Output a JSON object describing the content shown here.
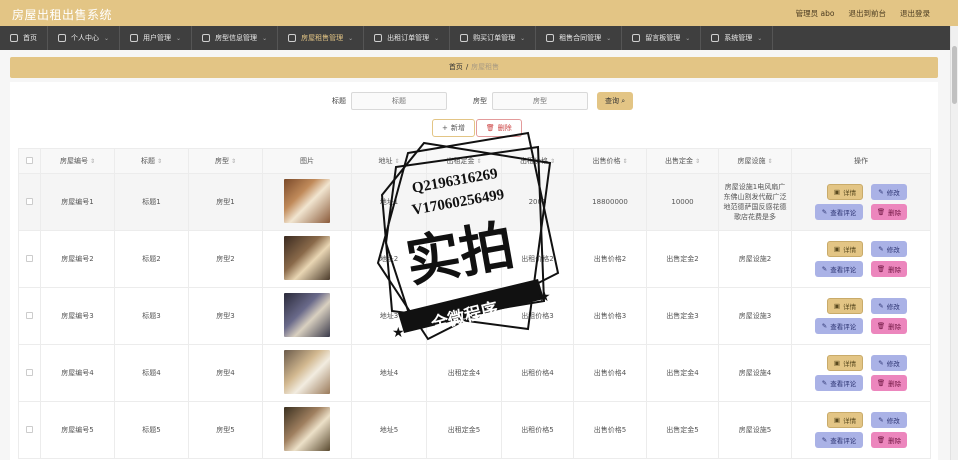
{
  "app": {
    "title": "房屋出租出售系统"
  },
  "top_links": {
    "admin": "管理员 abo",
    "frontend": "退出到前台",
    "logout": "退出登录"
  },
  "nav": [
    {
      "label": "首页",
      "icon": "home-icon",
      "chev": ""
    },
    {
      "label": "个人中心",
      "icon": "user-icon",
      "chev": "⌄"
    },
    {
      "label": "用户管理",
      "icon": "user-icon",
      "chev": "⌄"
    },
    {
      "label": "房型信息管理",
      "icon": "list-icon",
      "chev": "⌄"
    },
    {
      "label": "房屋租售管理",
      "icon": "house-icon",
      "chev": "⌄"
    },
    {
      "label": "出租订单管理",
      "icon": "order-icon",
      "chev": "⌄"
    },
    {
      "label": "购买订单管理",
      "icon": "location-icon",
      "chev": "⌄"
    },
    {
      "label": "租售合同管理",
      "icon": "contract-icon",
      "chev": "⌄"
    },
    {
      "label": "留言板管理",
      "icon": "board-icon",
      "chev": "⌄"
    },
    {
      "label": "系统管理",
      "icon": "clock-icon",
      "chev": "⌄"
    }
  ],
  "breadcrumb": {
    "home": "首页",
    "sep": "/",
    "current": "房屋租售"
  },
  "search": {
    "title_label": "标题",
    "title_placeholder": "标题",
    "type_label": "房型",
    "type_placeholder": "房型",
    "query_button": "查询"
  },
  "actions": {
    "add": "新增",
    "delete": "删除"
  },
  "table": {
    "headers": [
      "房屋编号",
      "标题",
      "房型",
      "图片",
      "地址",
      "出租定金",
      "出租价格",
      "出售价格",
      "出售定金",
      "房屋设施",
      "操作"
    ],
    "rows": [
      {
        "no": "房屋编号1",
        "title": "标题1",
        "type": "房型1",
        "addr": "地址1",
        "rent_deposit": "",
        "rent_price": "2000",
        "sale_price": "18800000",
        "sale_deposit": "10000",
        "facility": "房屋设施1电风扇广东佛山割发代截广泛地范德萨国反感花德歌店花费是多",
        "highlighted": true
      },
      {
        "no": "房屋编号2",
        "title": "标题2",
        "type": "房型2",
        "addr": "地址2",
        "rent_deposit": "",
        "rent_price": "出租价格2",
        "sale_price": "出售价格2",
        "sale_deposit": "出售定金2",
        "facility": "房屋设施2",
        "highlighted": false
      },
      {
        "no": "房屋编号3",
        "title": "标题3",
        "type": "房型3",
        "addr": "地址3",
        "rent_deposit": "出租定金3",
        "rent_price": "出租价格3",
        "sale_price": "出售价格3",
        "sale_deposit": "出售定金3",
        "facility": "房屋设施3",
        "highlighted": false
      },
      {
        "no": "房屋编号4",
        "title": "标题4",
        "type": "房型4",
        "addr": "地址4",
        "rent_deposit": "出租定金4",
        "rent_price": "出租价格4",
        "sale_price": "出售价格4",
        "sale_deposit": "出售定金4",
        "facility": "房屋设施4",
        "highlighted": false
      },
      {
        "no": "房屋编号5",
        "title": "标题5",
        "type": "房型5",
        "addr": "地址5",
        "rent_deposit": "出租定金5",
        "rent_price": "出租价格5",
        "sale_price": "出售价格5",
        "sale_deposit": "出售定金5",
        "facility": "房屋设施5",
        "highlighted": false
      }
    ],
    "row_ops": {
      "detail": "详情",
      "edit": "修改",
      "review": "查看评论",
      "delete": "删除"
    }
  },
  "stamp": {
    "line1": "Q2196316269",
    "line2": "V17060256499",
    "big": "实拍",
    "banner": "全微程序"
  },
  "colors": {
    "header": "#e3c585",
    "nav": "#3f3f3f",
    "edit": "#aab2e6",
    "delete": "#ec86bd"
  }
}
